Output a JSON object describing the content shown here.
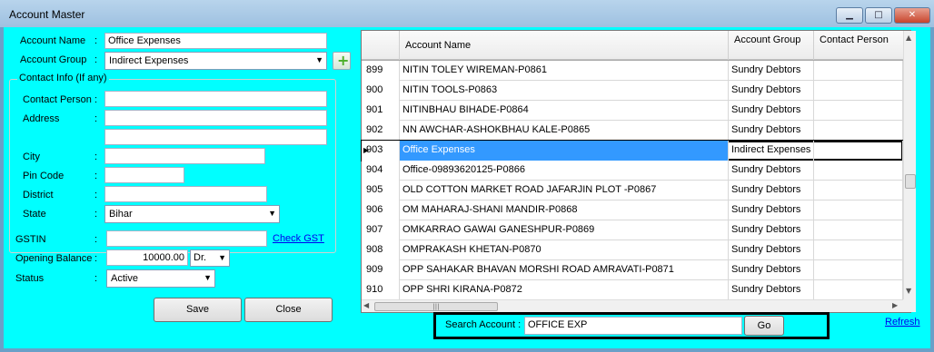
{
  "window": {
    "title": "Account Master",
    "min_glyph": "▁",
    "max_glyph": "□",
    "close_glyph": "✕"
  },
  "form": {
    "account_name": {
      "label": "Account Name",
      "value": "Office Expenses"
    },
    "account_group": {
      "label": "Account Group",
      "value": "Indirect Expenses"
    },
    "contact_info_legend": "Contact Info (If any)",
    "contact_person": {
      "label": "Contact Person",
      "value": ""
    },
    "address": {
      "label": "Address",
      "line1": "",
      "line2": ""
    },
    "city": {
      "label": "City",
      "value": ""
    },
    "pin_code": {
      "label": "Pin Code",
      "value": ""
    },
    "district": {
      "label": "District",
      "value": ""
    },
    "state": {
      "label": "State",
      "value": "Bihar"
    },
    "gstin": {
      "label": "GSTIN",
      "value": "",
      "check_link": "Check GST"
    },
    "opening_balance": {
      "label": "Opening Balance",
      "value": "10000.00",
      "type": "Dr."
    },
    "status": {
      "label": "Status",
      "value": "Active"
    },
    "colon": ":",
    "save_label": "Save",
    "close_label": "Close",
    "add_icon": "plus-icon",
    "plus_glyph": "+"
  },
  "grid": {
    "columns": [
      "Account Name",
      "Account Group",
      "Contact Person"
    ],
    "rows": [
      {
        "no": "899",
        "name": "NITIN TOLEY WIREMAN-P0861",
        "group": "Sundry Debtors",
        "contact": ""
      },
      {
        "no": "900",
        "name": "NITIN TOOLS-P0863",
        "group": "Sundry Debtors",
        "contact": ""
      },
      {
        "no": "901",
        "name": "NITINBHAU BIHADE-P0864",
        "group": "Sundry Debtors",
        "contact": ""
      },
      {
        "no": "902",
        "name": "NN AWCHAR-ASHOKBHAU KALE-P0865",
        "group": "Sundry Debtors",
        "contact": ""
      },
      {
        "no": "903",
        "name": "Office Expenses",
        "group": "Indirect Expenses",
        "contact": "",
        "selected": true
      },
      {
        "no": "904",
        "name": "Office-09893620125-P0866",
        "group": "Sundry Debtors",
        "contact": ""
      },
      {
        "no": "905",
        "name": "OLD COTTON MARKET ROAD JAFARJIN PLOT -P0867",
        "group": "Sundry Debtors",
        "contact": ""
      },
      {
        "no": "906",
        "name": "OM MAHARAJ-SHANI MANDIR-P0868",
        "group": "Sundry Debtors",
        "contact": ""
      },
      {
        "no": "907",
        "name": "OMKARRAO GAWAI GANESHPUR-P0869",
        "group": "Sundry Debtors",
        "contact": ""
      },
      {
        "no": "908",
        "name": "OMPRAKASH KHETAN-P0870",
        "group": "Sundry Debtors",
        "contact": ""
      },
      {
        "no": "909",
        "name": "OPP SAHAKAR BHAVAN MORSHI ROAD AMRAVATI-P0871",
        "group": "Sundry Debtors",
        "contact": ""
      },
      {
        "no": "910",
        "name": "OPP SHRI KIRANA-P0872",
        "group": "Sundry Debtors",
        "contact": ""
      }
    ]
  },
  "search": {
    "label": "Search Account :",
    "value": "OFFICE EXP",
    "go_label": "Go",
    "refresh_link": "Refresh"
  }
}
